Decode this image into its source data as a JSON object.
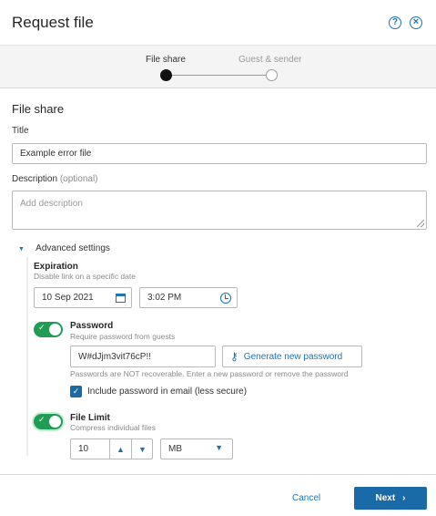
{
  "header": {
    "title": "Request file",
    "help_icon": "?",
    "close_icon": "×"
  },
  "stepper": {
    "steps": [
      {
        "label": "File share",
        "active": true
      },
      {
        "label": "Guest & sender",
        "active": false
      }
    ]
  },
  "form": {
    "section_title": "File share",
    "title_label": "Title",
    "title_value": "Example error file",
    "description_label": "Description",
    "description_optional": "(optional)",
    "description_placeholder": "Add description",
    "advanced_label": "Advanced settings",
    "advanced_expanded": true,
    "expiration": {
      "title": "Expiration",
      "desc": "Disable link on a specific date",
      "date": "10 Sep 2021",
      "time": "3:02 PM"
    },
    "password": {
      "enabled": true,
      "title": "Password",
      "desc": "Require password from guests",
      "value": "W#dJjm3vit76cP!!",
      "generate_label": "Generate new password",
      "note": "Passwords are NOT recoverable. Enter a new password or remove the password",
      "include_in_email_checked": true,
      "include_in_email_label": "Include password in email (less secure)"
    },
    "file_limit": {
      "enabled": true,
      "title": "File Limit",
      "desc": "Compress individual files",
      "value": "10",
      "unit": "MB"
    }
  },
  "footer": {
    "cancel_label": "Cancel",
    "next_label": "Next",
    "next_arrow": "›"
  },
  "colors": {
    "accent": "#1a73b5",
    "primary_button": "#1a6aa8",
    "toggle_on": "#1f9d55"
  }
}
